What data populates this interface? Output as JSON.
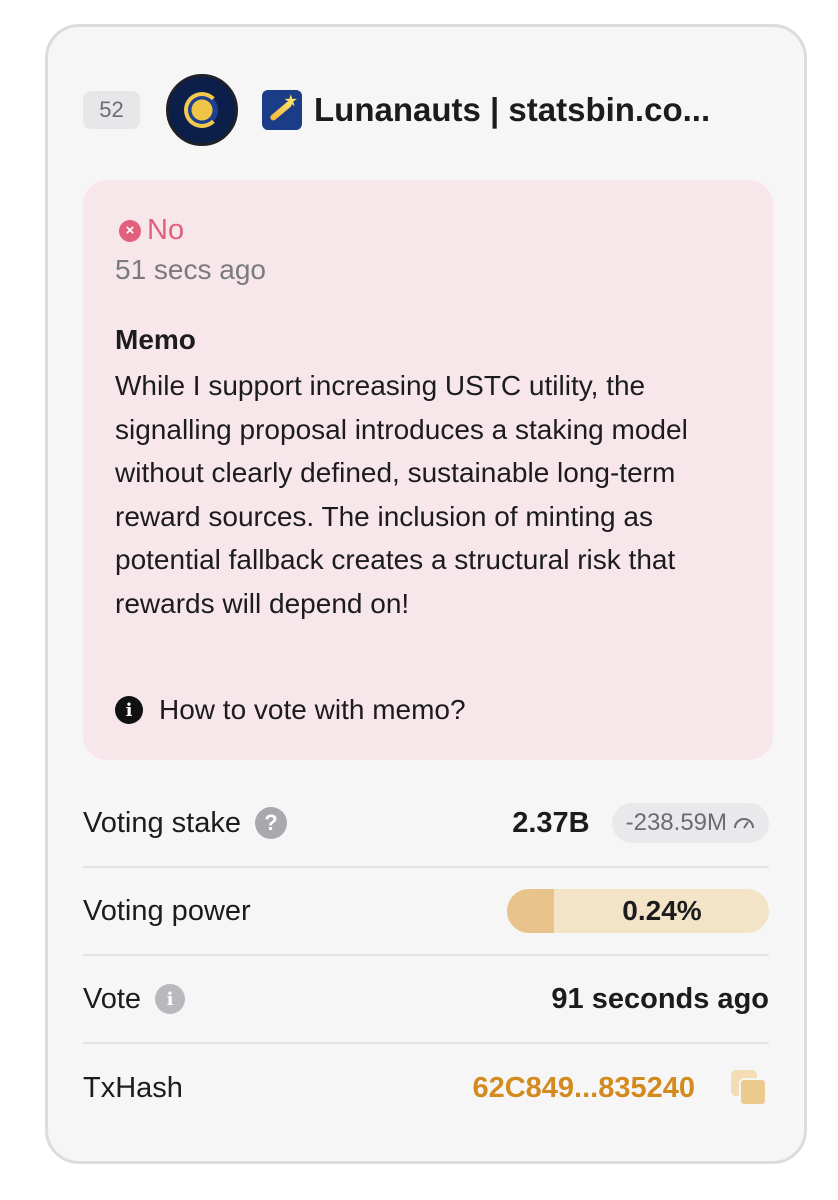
{
  "validator": {
    "rank": "52",
    "name": "Lunanauts | statsbin.co..."
  },
  "vote": {
    "option": "No",
    "time_ago": "51 secs ago",
    "memo_title": "Memo",
    "memo_text": "While I support increasing USTC utility, the signalling proposal introduces a staking model without clearly defined, sustainable long-term reward sources. The inclusion of minting as potential fallback creates a structural risk that rewards will depend on!",
    "help_link": "How to vote with memo?"
  },
  "details": {
    "voting_stake": {
      "label": "Voting stake",
      "value": "2.37B",
      "delta": "-238.59M"
    },
    "voting_power": {
      "label": "Voting power",
      "value": "0.24%",
      "fill_fraction": 0.18
    },
    "vote_time": {
      "label": "Vote",
      "value": "91 seconds ago"
    },
    "txhash": {
      "label": "TxHash",
      "value": "62C849...835240"
    }
  },
  "colors": {
    "no_vote": "#e0607e",
    "memo_bg": "#f7e7ea",
    "accent_orange": "#d38b1f",
    "power_fill": "#e8c48c"
  },
  "icons": {
    "no": "x-circle-icon",
    "help": "info-icon",
    "stake_help": "question-icon",
    "vote_info": "info-icon",
    "delta": "gauge-icon",
    "copy": "copy-icon"
  }
}
